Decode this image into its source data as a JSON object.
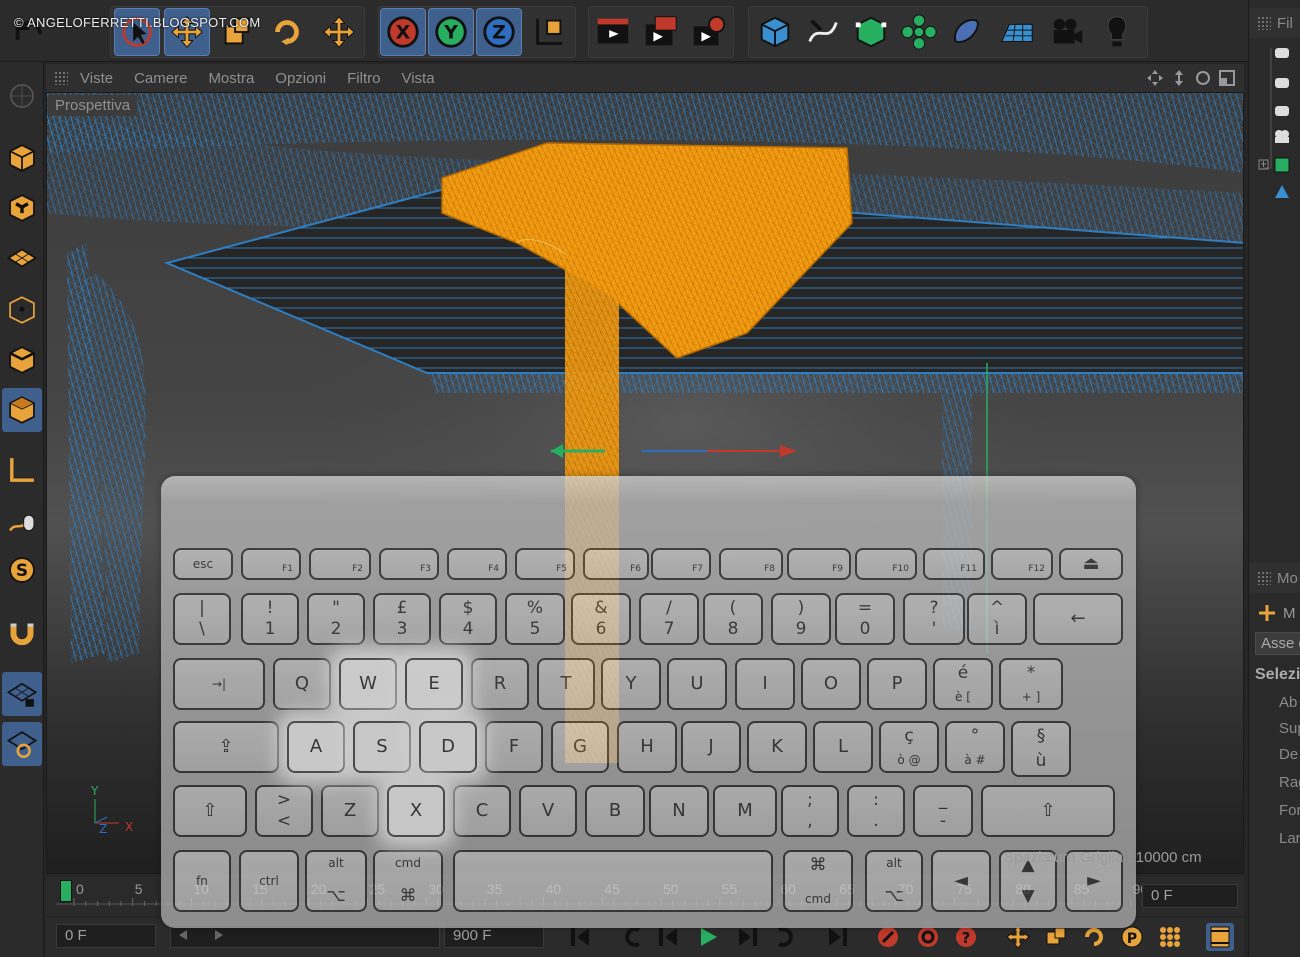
{
  "watermark": "© ANGELOFERRETTI.BLOGSPOT.COM",
  "toolbar": {
    "tools": [
      "undo-icon",
      "live-selection-icon",
      "move-icon",
      "scale-icon",
      "rotate-icon",
      "move-tool-icon",
      "x-axis-lock-icon",
      "y-axis-lock-icon",
      "z-axis-lock-icon",
      "coordinate-system-icon",
      "render-view-icon",
      "render-picture-viewer-icon",
      "render-settings-icon",
      "cube-icon",
      "spline-pen-icon",
      "nurbs-icon",
      "array-icon",
      "deformer-icon",
      "floor-icon",
      "camera-icon",
      "light-icon"
    ],
    "axis_x": "X",
    "axis_y": "Y",
    "axis_z": "Z"
  },
  "viewport": {
    "menu": [
      "Viste",
      "Camere",
      "Mostra",
      "Opzioni",
      "Filtro",
      "Vista"
    ],
    "label": "Prospettiva",
    "grid_info": "Spaziatura Griglia : 10000 cm",
    "axis_y": "Y",
    "axis_z": "Z",
    "axis_x": "X"
  },
  "left_palette": [
    "make-editable-icon",
    "model-mode-icon",
    "texture-mode-icon",
    "workplane-icon",
    "points-mode-icon",
    "edges-mode-icon",
    "polygons-mode-icon",
    "axis-mode-icon",
    "tweak-mode-icon",
    "snap-icon",
    "magnet-icon",
    "workplane-lock-icon",
    "workplane-rotate-icon"
  ],
  "keyboard": {
    "rows": [
      [
        {
          "t": "esc"
        },
        {
          "s": "F1"
        },
        {
          "s": "F2"
        },
        {
          "s": "F3"
        },
        {
          "s": "F4"
        },
        {
          "s": "F5"
        },
        {
          "s": "F6"
        },
        {
          "s": "F7"
        },
        {
          "s": "F8"
        },
        {
          "s": "F9"
        },
        {
          "s": "F10"
        },
        {
          "s": "F11"
        },
        {
          "s": "F12"
        },
        {
          "t": "⏏"
        }
      ],
      [
        {
          "u": "|",
          "d": "\\"
        },
        {
          "u": "!",
          "d": "1"
        },
        {
          "u": "\"",
          "d": "2"
        },
        {
          "u": "£",
          "d": "3"
        },
        {
          "u": "$",
          "d": "4"
        },
        {
          "u": "%",
          "d": "5"
        },
        {
          "u": "&",
          "d": "6"
        },
        {
          "u": "/",
          "d": "7"
        },
        {
          "u": "(",
          "d": "8"
        },
        {
          "u": ")",
          "d": "9"
        },
        {
          "u": "=",
          "d": "0"
        },
        {
          "u": "?",
          "d": "'"
        },
        {
          "u": "^",
          "d": "ì"
        },
        {
          "t": "←"
        }
      ],
      [
        {
          "t": "→|"
        },
        {
          "t": "Q"
        },
        {
          "t": "W"
        },
        {
          "t": "E"
        },
        {
          "t": "R"
        },
        {
          "t": "T"
        },
        {
          "t": "Y"
        },
        {
          "t": "U"
        },
        {
          "t": "I"
        },
        {
          "t": "O"
        },
        {
          "t": "P"
        },
        {
          "u": "é",
          "d": "è ["
        },
        {
          "u": "*",
          "d": "+ ]"
        },
        {
          "t": "↩"
        }
      ],
      [
        {
          "t": "⇪"
        },
        {
          "t": "A"
        },
        {
          "t": "S"
        },
        {
          "t": "D"
        },
        {
          "t": "F"
        },
        {
          "t": "G"
        },
        {
          "t": "H"
        },
        {
          "t": "J"
        },
        {
          "t": "K"
        },
        {
          "t": "L"
        },
        {
          "u": "ç",
          "d": "ò @"
        },
        {
          "u": "°",
          "d": "à #"
        },
        {
          "u": "§",
          "d": "ù"
        }
      ],
      [
        {
          "t": "⇧"
        },
        {
          "u": ">",
          "d": "<"
        },
        {
          "t": "Z"
        },
        {
          "t": "X"
        },
        {
          "t": "C"
        },
        {
          "t": "V"
        },
        {
          "t": "B"
        },
        {
          "t": "N"
        },
        {
          "t": "M"
        },
        {
          "u": ";",
          "d": ","
        },
        {
          "u": ":",
          "d": "."
        },
        {
          "u": "_",
          "d": "-"
        },
        {
          "t": "⇧"
        }
      ],
      [
        {
          "t": "fn"
        },
        {
          "t": "ctrl"
        },
        {
          "u": "alt",
          "d": "⌥"
        },
        {
          "u": "cmd",
          "d": "⌘"
        },
        {
          "t": ""
        },
        {
          "u": "⌘",
          "d": "cmd"
        },
        {
          "u": "alt",
          "d": "⌥"
        },
        {
          "t": "◄"
        },
        {
          "u": "▲",
          "d": "▼"
        },
        {
          "t": "►"
        }
      ]
    ],
    "highlighted": [
      "W",
      "E",
      "A",
      "S",
      "D",
      "X"
    ]
  },
  "timeline": {
    "ticks": [
      "0",
      "5",
      "10",
      "15",
      "20",
      "25",
      "30",
      "35",
      "40",
      "45",
      "50",
      "55",
      "60",
      "65",
      "70",
      "75",
      "80",
      "85",
      "90"
    ],
    "current_frame": "0 F"
  },
  "transport": {
    "start_frame": "0 F",
    "end_frame": "900 F",
    "buttons": [
      "go-to-start-icon",
      "prev-key-icon",
      "prev-frame-icon",
      "play-icon",
      "next-frame-icon",
      "next-key-icon",
      "go-to-end-icon",
      "record-icon",
      "auto-key-icon",
      "keyframe-selection-icon",
      "key-move-icon",
      "key-scale-icon",
      "key-rotate-icon",
      "key-param-icon",
      "key-pla-icon",
      "timeline-icon"
    ]
  },
  "right_panel": {
    "objects_header": "Fil",
    "attributes_header": "Mo",
    "tab": "Asse d",
    "section": "Selezi",
    "items": [
      "Ab",
      "Sup",
      "De",
      "Rag",
      "For",
      "Lar"
    ]
  },
  "colors": {
    "accent": "#3f5f8c",
    "selection": "#f39c12",
    "wire": "#2f7ec2"
  }
}
